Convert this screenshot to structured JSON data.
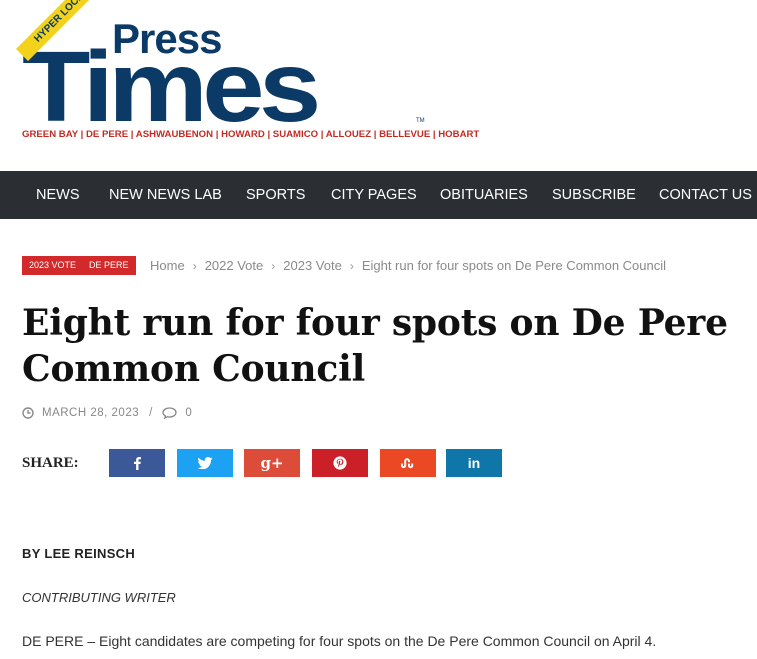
{
  "logo": {
    "press": "Press",
    "times": "Times",
    "ribbon": "HYPER LOCAL",
    "tm": "TM",
    "cities": "GREEN BAY | DE PERE | ASHWAUBENON | HOWARD | SUAMICO | ALLOUEZ | BELLEVUE | HOBART"
  },
  "nav": {
    "items": [
      "NEWS",
      "NEW NEWS LAB",
      "SPORTS",
      "CITY PAGES",
      "OBITUARIES",
      "SUBSCRIBE",
      "CONTACT US"
    ]
  },
  "tags": [
    "2023 VOTE",
    "DE PERE"
  ],
  "breadcrumb": [
    "Home",
    "2022 Vote",
    "2023 Vote",
    "Eight run for four spots on De Pere Common Council"
  ],
  "article": {
    "title": "Eight run for four spots on De Pere Common Council",
    "date": "MARCH 28, 2023",
    "comments": "0",
    "share_label": "SHARE:",
    "byline": "BY LEE REINSCH",
    "role": "CONTRIBUTING WRITER",
    "first_paragraph": "DE PERE – Eight candidates are competing for four spots on the De Pere Common Council on April 4."
  },
  "share_buttons": [
    {
      "icon": "facebook-icon",
      "color": "#3b5998"
    },
    {
      "icon": "twitter-icon",
      "color": "#1da1f2"
    },
    {
      "icon": "google-plus-icon",
      "color": "#dd4b39"
    },
    {
      "icon": "pinterest-icon",
      "color": "#cb2027"
    },
    {
      "icon": "stumbleupon-icon",
      "color": "#eb4924"
    },
    {
      "icon": "linkedin-icon",
      "color": "#0e76a8"
    }
  ],
  "colors": {
    "nav_bg": "#2b2f33",
    "tag_red": "#d22a2a",
    "logo_blue": "#0c3a66",
    "logo_red": "#c22b24",
    "logo_yellow": "#f2d21a"
  }
}
